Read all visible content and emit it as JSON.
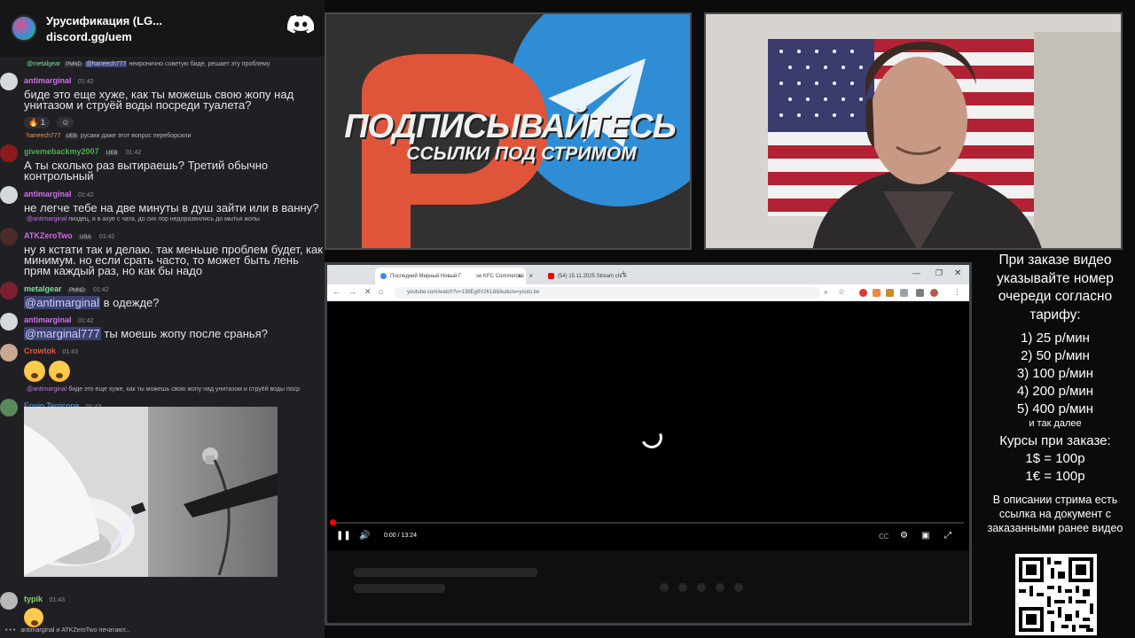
{
  "chat": {
    "server_name": "Урусификация (LG...",
    "invite": "discord.gg/uem",
    "messages": [
      {
        "reply_name": "@metalgear",
        "reply_badge": "PMND",
        "reply_mention": "@haneech777",
        "reply_text": "неиронично советую биде, решает эту проблему"
      },
      {
        "name": "antimarginal",
        "time": "01:42",
        "text": "биде это еще хуже, как ты можешь свою жопу над унитазом и струёй воды посреди туалета?",
        "reaction_count": "1"
      },
      {
        "reply_name": "haneech777",
        "reply_badge": "UEB",
        "reply_text": "русаки даже этот вопрос переборсили"
      },
      {
        "name": "givemebackmy2007",
        "badge": "UEB",
        "time": "01:42",
        "text": "А ты сколько раз вытираешь? Третий обычно контрольный"
      },
      {
        "name": "antimarginal",
        "time": "01:42",
        "text": "не легче тебе на две минуты в душ зайти или в ванну?"
      },
      {
        "reply_name": "@antimarginal",
        "reply_text": "пиздец, я в ахуе с чата, до сих пор недоразвились до мытья жопы"
      },
      {
        "name": "ATKZeroTwo",
        "badge": "USA",
        "time": "01:42",
        "text": "ну я кстати так и делаю. так меньше проблем будет, как минимум. но если срать часто, то может быть лень прям каждый раз, но как бы надо"
      },
      {
        "name": "metalgear",
        "badge": "PMND",
        "time": "01:42",
        "mention": "@antimarginal",
        "text": " в одежде?"
      },
      {
        "name": "antimarginal",
        "time": "01:42",
        "mention": "@marginal777",
        "text": " ты моешь жопу после сранья?"
      },
      {
        "name": "Crowtok",
        "time": "01:43"
      },
      {
        "reply_name": "@antimarginal",
        "reply_text": "биде это еще хуже, как ты можешь свою жопу над унитазом и струёй воды поср"
      },
      {
        "name": "Ennio Terricone",
        "time": "01:43"
      },
      {
        "name": "typik",
        "time": "01:43"
      }
    ],
    "typing": "antimarginal и ATKZeroTwo печатают..."
  },
  "promo": {
    "title": "ПОДПИСЫВАЙТЕСЬ",
    "subtitle": "ССЫЛКИ ПОД СТРИМОМ"
  },
  "browser": {
    "tabs": [
      {
        "label": "Последний Мирный Новый Г",
        "favicon_color": "#4285f4"
      },
      {
        "label": "se KFC Commercial",
        "favicon_color": "#9aa0a6"
      },
      {
        "label": "(54) 15.11.2025 Stream chi",
        "favicon_color": "#ff0000"
      }
    ],
    "url": "youtube.com/watch?v=138Eg8V2KL8&feature=youtu.be",
    "time": "0:00 / 13:24"
  },
  "info": {
    "order_text": "При заказе видео указывайте номер очереди согласно тарифу:",
    "tariffs": [
      "1) 25 р/мин",
      "2) 50 р/мин",
      "3) 100 р/мин",
      "4) 200 р/мин",
      "5) 400 р/мин"
    ],
    "and_so_on": "и так далее",
    "rates_title": "Курсы при заказе:",
    "rate1": "1$ = 100р",
    "rate2": "1€ = 100р",
    "description": "В описании стрима есть ссылка на документ с заказанными ранее видео"
  },
  "colors": {
    "discord_bg": "#202024",
    "antimarginal": "#c773e6",
    "atk": "#d26ae6",
    "metalgear": "#7ae0a0",
    "given": "#4caf50",
    "crowtok": "#e45b3f",
    "ennio": "#57a6ee",
    "typik": "#8bd06b",
    "youtube_red": "#ff0000"
  }
}
